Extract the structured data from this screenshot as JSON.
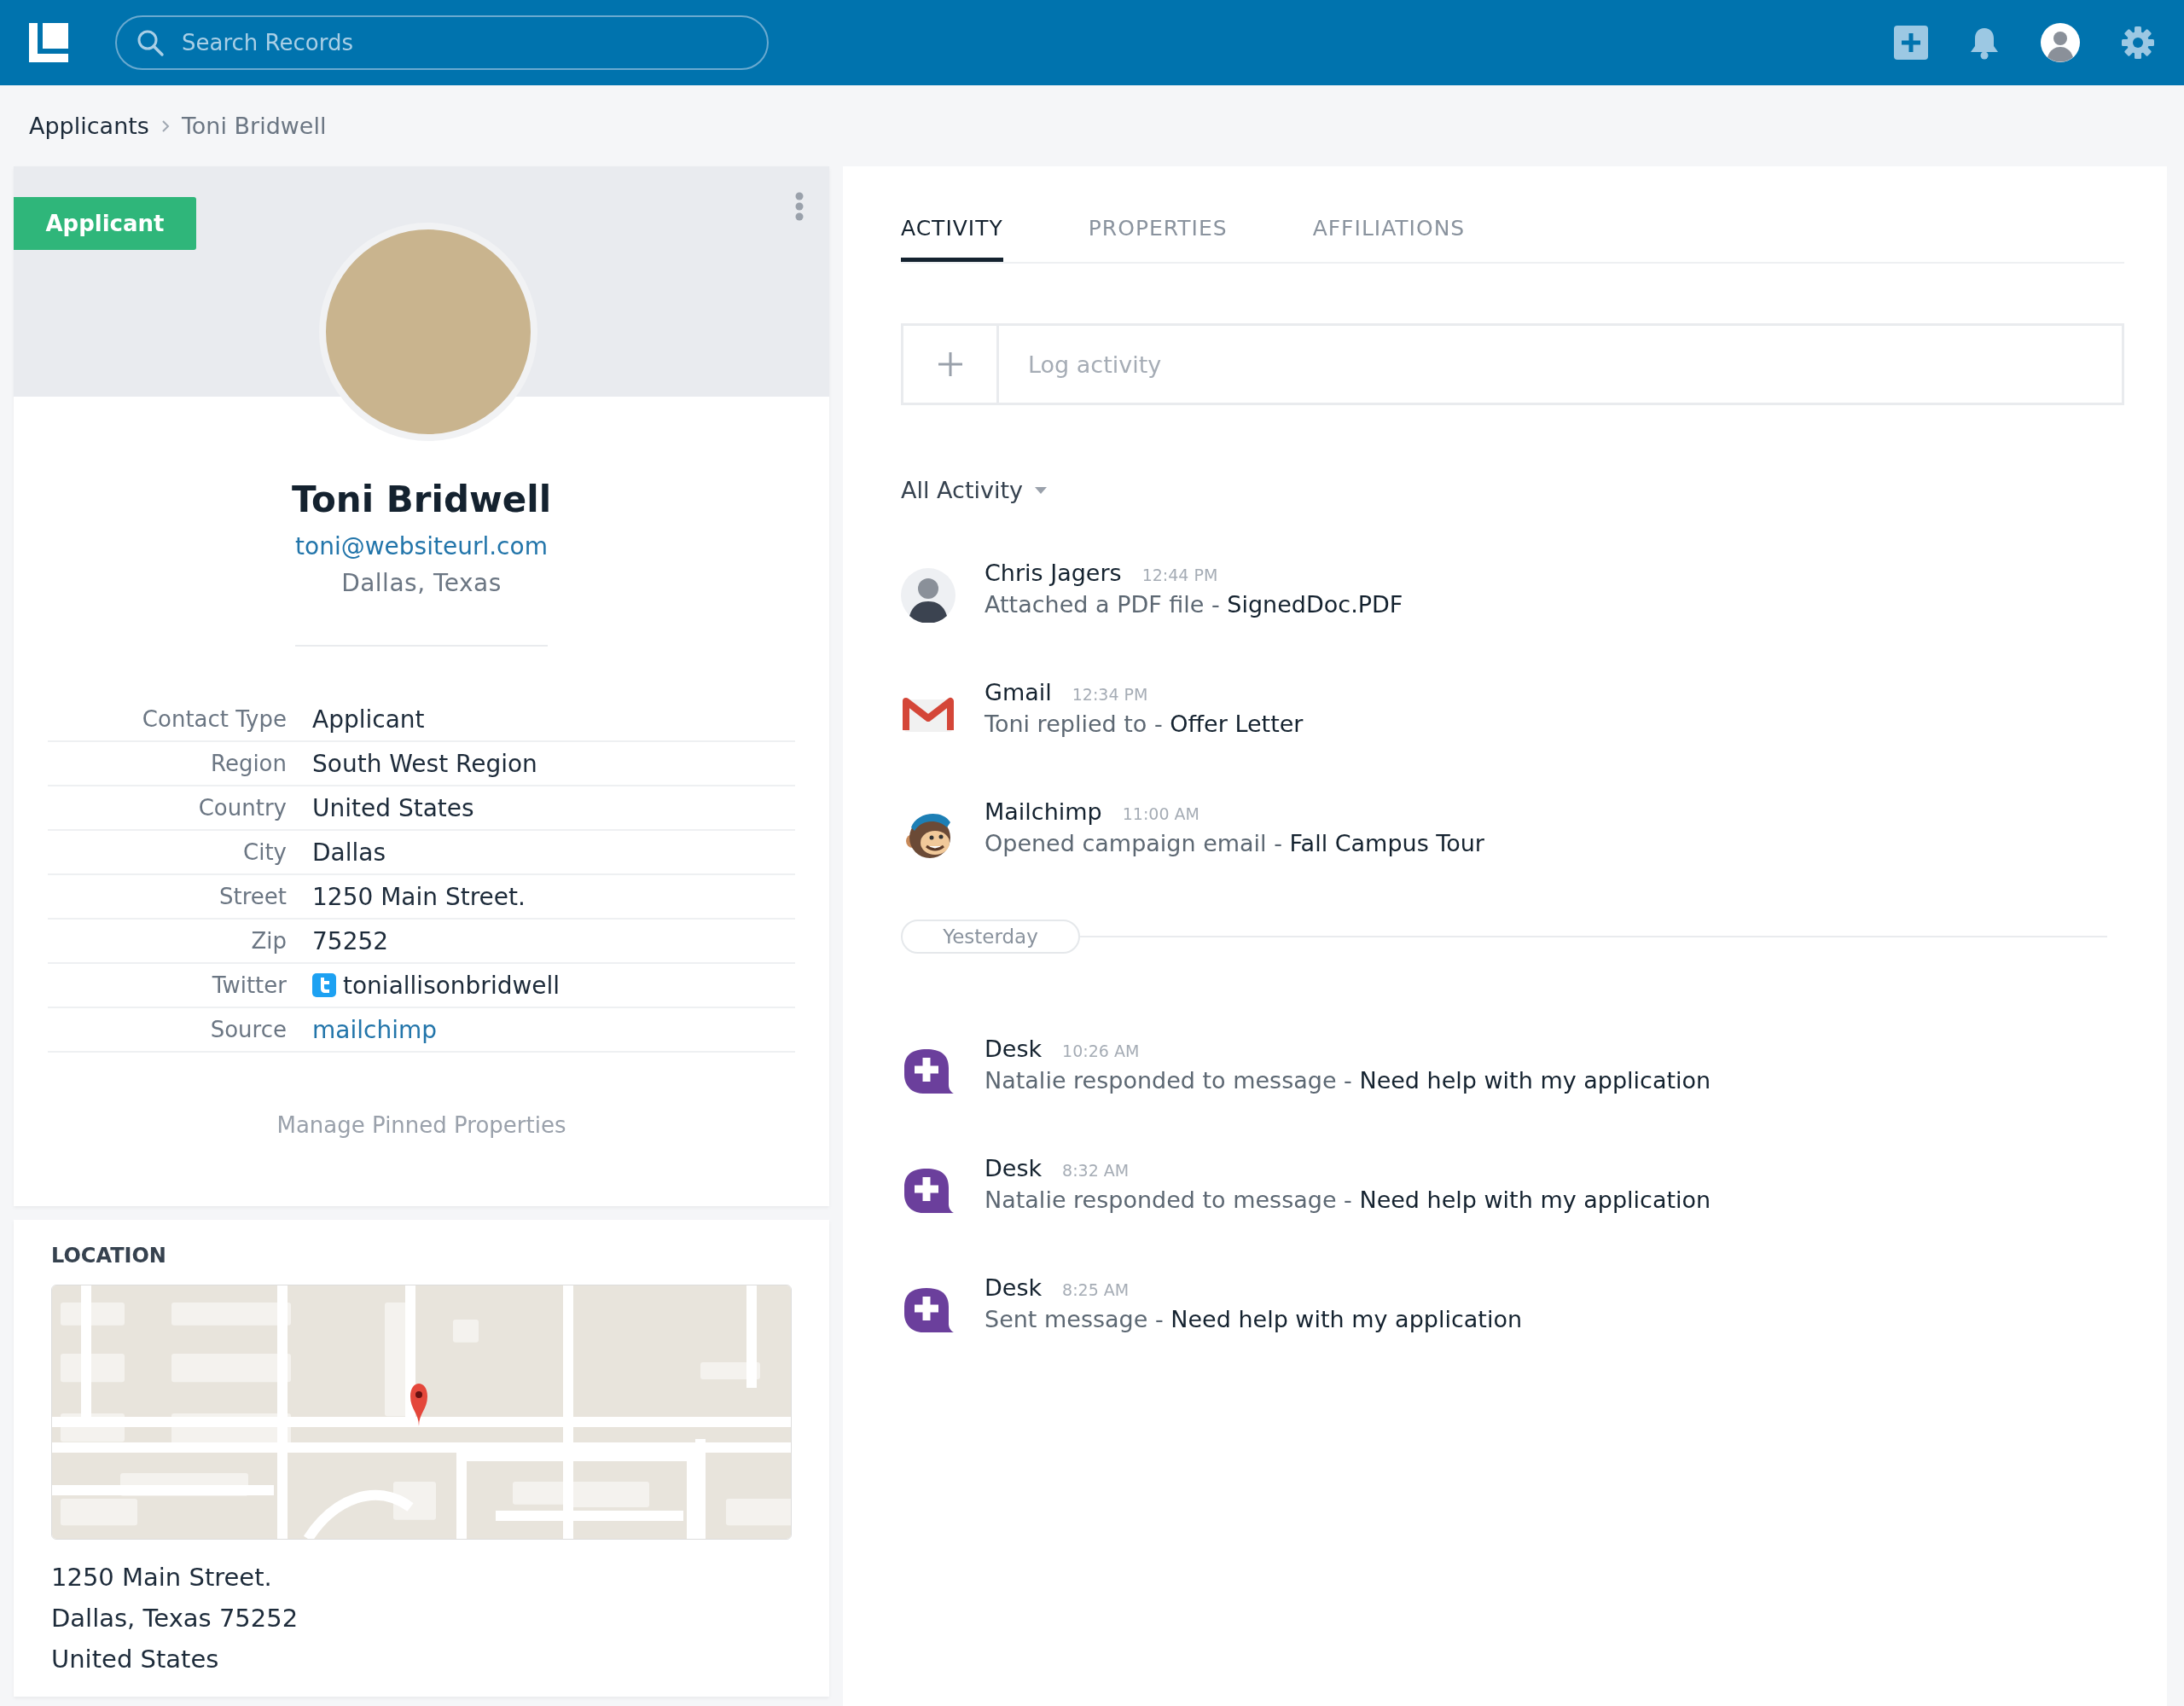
{
  "top_bar": {
    "search": {
      "placeholder": "Search Records"
    }
  },
  "breadcrumb": [
    {
      "label": "Applicants",
      "current": false
    },
    {
      "label": "Toni Bridwell",
      "current": true
    }
  ],
  "profile": {
    "badge": "Applicant",
    "name": "Toni Bridwell",
    "email": "toni@websiteurl.com",
    "location": "Dallas, Texas",
    "details": [
      {
        "label": "Contact Type",
        "value": "Applicant",
        "kind": "text"
      },
      {
        "label": "Region",
        "value": "South West Region",
        "kind": "text"
      },
      {
        "label": "Country",
        "value": "United States",
        "kind": "text"
      },
      {
        "label": "City",
        "value": "Dallas",
        "kind": "text"
      },
      {
        "label": "Street",
        "value": "1250 Main Street.",
        "kind": "text"
      },
      {
        "label": "Zip",
        "value": "75252",
        "kind": "text"
      },
      {
        "label": "Twitter",
        "value": "toniallisonbridwell",
        "kind": "twitter"
      },
      {
        "label": "Source",
        "value": "mailchimp",
        "kind": "link"
      }
    ],
    "manage_link": "Manage Pinned Properties"
  },
  "location": {
    "title": "LOCATION",
    "address_lines": [
      "1250 Main Street.",
      "Dallas, Texas 75252",
      "United States"
    ]
  },
  "tabs": [
    {
      "label": "ACTIVITY",
      "selected": true
    },
    {
      "label": "PROPERTIES",
      "selected": false
    },
    {
      "label": "AFFILIATIONS",
      "selected": false
    }
  ],
  "log_activity": {
    "placeholder": "Log activity"
  },
  "filter": {
    "label": "All Activity"
  },
  "activity_groups": [
    {
      "items": [
        {
          "kind": "person",
          "source": "Chris Jagers",
          "time": "12:44 PM",
          "action": "Attached a PDF file -",
          "subject": "SignedDoc.PDF"
        },
        {
          "kind": "gmail",
          "source": "Gmail",
          "time": "12:34 PM",
          "action": "Toni replied to -",
          "subject": "Offer Letter"
        },
        {
          "kind": "mailchimp",
          "source": "Mailchimp",
          "time": "11:00 AM",
          "action": "Opened campaign email -",
          "subject": "Fall Campus Tour"
        }
      ]
    },
    {
      "divider": "Yesterday",
      "items": [
        {
          "kind": "desk",
          "source": "Desk",
          "time": "10:26 AM",
          "action": "Natalie responded to message -",
          "subject": "Need help with my application"
        },
        {
          "kind": "desk",
          "source": "Desk",
          "time": "8:32 AM",
          "action": "Natalie responded to message -",
          "subject": "Need help with my application"
        },
        {
          "kind": "desk",
          "source": "Desk",
          "time": "8:25 AM",
          "action": "Sent message -",
          "subject": "Need help with my application"
        }
      ]
    }
  ]
}
